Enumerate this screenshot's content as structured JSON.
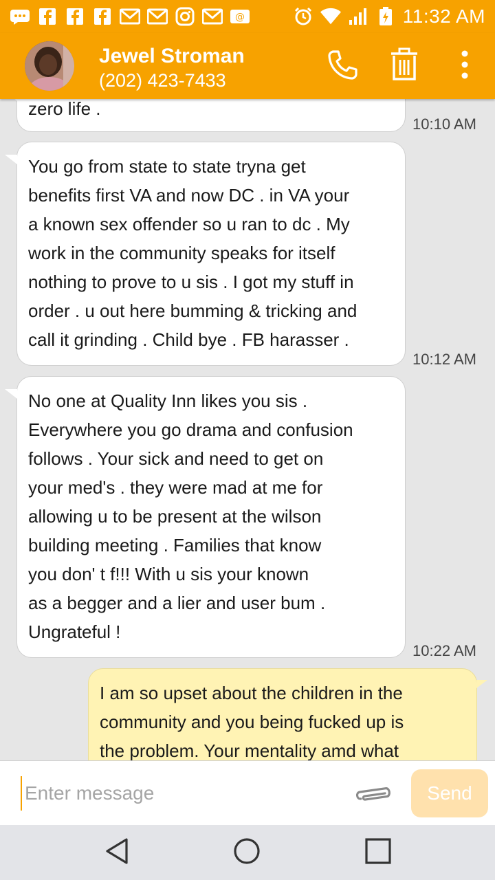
{
  "status_bar": {
    "time": "11:32 AM",
    "left_icons": [
      "message-icon",
      "facebook-icon",
      "facebook-icon",
      "facebook-icon",
      "gmail-icon",
      "gmail-icon",
      "instagram-icon",
      "gmail-icon",
      "email-at-icon"
    ],
    "right_icons": [
      "alarm-icon",
      "wifi-icon",
      "signal-icon",
      "battery-icon"
    ]
  },
  "header": {
    "name": "Jewel Stroman",
    "phone": "(202) 423-7433",
    "actions": [
      "call-icon",
      "delete-icon",
      "more-icon"
    ],
    "color": "#f7a200"
  },
  "messages": [
    {
      "direction": "incoming",
      "text": "zero life .",
      "time": "10:10 AM"
    },
    {
      "direction": "incoming",
      "lines": [
        "You go from state to state tryna get",
        "benefits first VA and now DC . in VA your",
        "a known sex offender so u ran to dc . My",
        "work in the community speaks for itself",
        "nothing to prove to u sis . I got my stuff in",
        "order . u out here bumming & tricking and",
        "call it grinding . Child bye . FB harasser ."
      ],
      "time": "10:12 AM"
    },
    {
      "direction": "incoming",
      "lines": [
        "No one at Quality Inn likes you sis .",
        "Everywhere you go drama and confusion",
        "follows . Your sick and need to get on",
        "your med's . they were mad at me for",
        "allowing u to be present at the wilson",
        "building meeting . Families that know",
        "you don' t f!!! With u sis your known",
        "as a begger and a lier and user bum .",
        "Ungrateful !"
      ],
      "time": "10:22 AM"
    },
    {
      "direction": "outgoing",
      "lines": [
        "I am so upset about the children in the",
        "community and you being fucked up is",
        "the problem. Your mentality amd what"
      ]
    }
  ],
  "composer": {
    "placeholder": "Enter message",
    "send_label": "Send"
  },
  "nav": [
    "back-icon",
    "home-icon",
    "recents-icon"
  ]
}
